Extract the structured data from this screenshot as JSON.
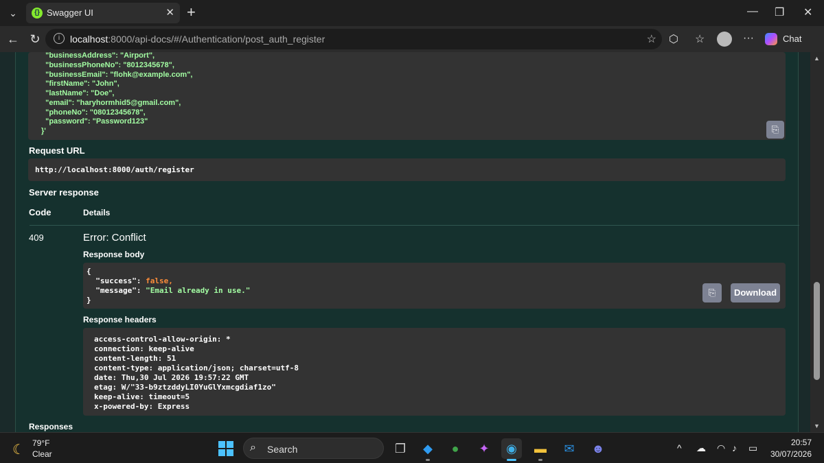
{
  "browser": {
    "tab_title": "Swagger UI",
    "url_host": "localhost",
    "url_rest": ":8000/api-docs/#/Authentication/post_auth_register",
    "chat_label": "Chat"
  },
  "curl_body_lines": [
    "  \"businessAddress\": \"Airport\",",
    "  \"businessPhoneNo\": \"8012345678\",",
    "  \"businessEmail\": \"flohk@example.com\",",
    "  \"firstName\": \"John\",",
    "  \"lastName\": \"Doe\",",
    "  \"email\": \"haryhormhid5@gmail.com\",",
    "  \"phoneNo\": \"08012345678\",",
    "  \"password\": \"Password123\"",
    "}'"
  ],
  "request_url": {
    "label": "Request URL",
    "value": "http://localhost:8000/auth/register"
  },
  "server_response": {
    "label": "Server response",
    "col_code": "Code",
    "col_details": "Details",
    "code": "409",
    "error_title": "Error: Conflict",
    "body_label": "Response body",
    "body": {
      "open": "{",
      "success_key": "  \"success\": ",
      "success_val": "false,",
      "message_key": "  \"message\": ",
      "message_val": "\"Email already in use.\"",
      "close": "}"
    },
    "download_label": "Download",
    "headers_label": "Response headers",
    "headers": [
      "access-control-allow-origin: *",
      "connection: keep-alive",
      "content-length: 51",
      "content-type: application/json; charset=utf-8",
      "date: Thu,30 Jul 2026 19:57:22 GMT",
      "etag: W/\"33-b9ztzddyLI0YuGlYxmcgdiaf1zo\"",
      "keep-alive: timeout=5",
      "x-powered-by: Express"
    ]
  },
  "responses_label": "Responses",
  "taskbar": {
    "weather_temp": "79°F",
    "weather_cond": "Clear",
    "search_label": "Search",
    "time": "20:57",
    "date": "30/07/2026"
  },
  "icons": {
    "tab_favicon": "{}",
    "copy": "⎘"
  }
}
